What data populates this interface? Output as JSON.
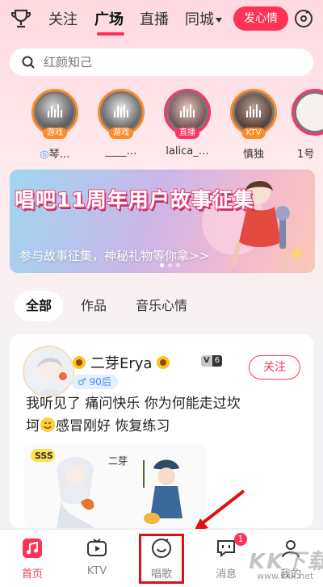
{
  "header": {
    "tabs": [
      {
        "label": "关注",
        "active": false
      },
      {
        "label": "广场",
        "active": true
      },
      {
        "label": "直播",
        "active": false
      },
      {
        "label": "同城",
        "active": false
      }
    ],
    "mood_button": "发心情",
    "icons": [
      "trophy-icon",
      "sing-record-icon"
    ]
  },
  "search": {
    "placeholder": "红颜知己"
  },
  "live": [
    {
      "name": "琴…",
      "badge": "游戏"
    },
    {
      "name": "____…",
      "badge": "游戏"
    },
    {
      "name": "lalica_…",
      "badge": "直播"
    },
    {
      "name": "慎独",
      "badge": "KTV"
    },
    {
      "name": "1号",
      "badge": ""
    }
  ],
  "banner": {
    "title": "唱吧11周年用户故事征集",
    "subtitle": "参与故事征集，神秘礼物等你拿>>"
  },
  "categories": [
    {
      "label": "全部",
      "active": true
    },
    {
      "label": "作品",
      "active": false
    },
    {
      "label": "音乐心情",
      "active": false
    }
  ],
  "post": {
    "username": "二芽Erya",
    "vip_letter": "V",
    "vip_level": "6",
    "age": "♂ 90后",
    "follow": "关注",
    "text_line1": "我听见了 痛问快乐 你为何能走过坎",
    "text_line2_a": "坷",
    "text_line2_b": "感冒刚好 恢复练习",
    "image_tag": "SSS",
    "image_caption": "二芽"
  },
  "bottom_nav": [
    {
      "label": "首页",
      "active": true
    },
    {
      "label": "KTV",
      "active": false
    },
    {
      "label": "唱歌",
      "active": false
    },
    {
      "label": "消息",
      "active": false,
      "badge": "1"
    },
    {
      "label": "我的",
      "active": false
    }
  ],
  "watermark": {
    "text": "KK下载",
    "url": "www.kkx.net"
  },
  "colors": {
    "accent": "#ff3355",
    "live_orange": "#ff8a2a",
    "annotation_red": "#e01010"
  }
}
